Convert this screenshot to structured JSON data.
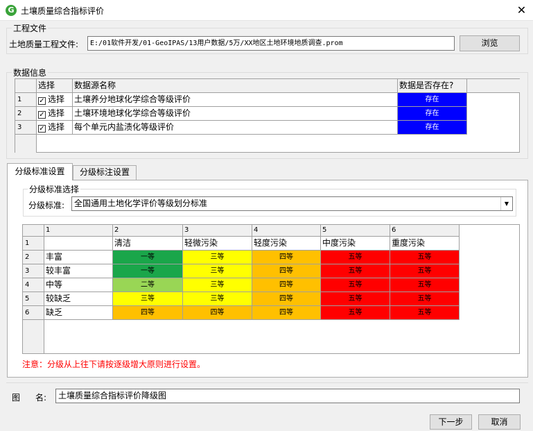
{
  "window": {
    "title": "土壤质量综合指标评价",
    "app_icon": "G",
    "close_glyph": "✕"
  },
  "project": {
    "group_label": "工程文件",
    "field_label": "土地质量工程文件:",
    "path": "E:/01软件开发/01-GeoIPAS/13用户数据/5万/XX地区土地环境地质调查.prom",
    "browse_label": "浏览"
  },
  "data_info": {
    "group_label": "数据信息",
    "columns": [
      "选择",
      "数据源名称",
      "数据是否存在?"
    ],
    "rows": [
      {
        "num": "1",
        "select_label": "选择",
        "checked": true,
        "name": "土壤养分地球化学综合等级评价",
        "status": "存在"
      },
      {
        "num": "2",
        "select_label": "选择",
        "checked": true,
        "name": "土壤环境地球化学综合等级评价",
        "status": "存在"
      },
      {
        "num": "3",
        "select_label": "选择",
        "checked": true,
        "name": "每个单元内盐渍化等级评价",
        "status": "存在"
      }
    ]
  },
  "tabs": [
    {
      "label": "分级标准设置",
      "active": true
    },
    {
      "label": "分级标注设置",
      "active": false
    }
  ],
  "standard": {
    "group_label": "分级标准选择",
    "field_label": "分级标准:",
    "value": "全国通用土地化学评价等级划分标准",
    "arrow": "▼"
  },
  "grade_grid": {
    "col_headers": [
      "1",
      "2",
      "3",
      "4",
      "5",
      "6"
    ],
    "row_headers": [
      "1",
      "2",
      "3",
      "4",
      "5",
      "6"
    ],
    "top_row": [
      "",
      "清洁",
      "轻微污染",
      "轻度污染",
      "中度污染",
      "重度污染"
    ],
    "rows": [
      {
        "label": "丰富",
        "cells": [
          "一等",
          "三等",
          "四等",
          "五等",
          "五等"
        ]
      },
      {
        "label": "较丰富",
        "cells": [
          "一等",
          "三等",
          "四等",
          "五等",
          "五等"
        ]
      },
      {
        "label": "中等",
        "cells": [
          "二等",
          "三等",
          "四等",
          "五等",
          "五等"
        ]
      },
      {
        "label": "较缺乏",
        "cells": [
          "三等",
          "三等",
          "四等",
          "五等",
          "五等"
        ]
      },
      {
        "label": "缺乏",
        "cells": [
          "四等",
          "四等",
          "四等",
          "五等",
          "五等"
        ]
      }
    ],
    "grade_colors": {
      "一等": "#1aa64a",
      "二等": "#99d655",
      "三等": "#ffff00",
      "四等": "#ffc000",
      "五等": "#ff0000"
    }
  },
  "note": "注意：分级从上往下请按逐级增大原则进行设置。",
  "map_name": {
    "label_1": "图",
    "label_2": "名:",
    "value": "土壤质量综合指标评价降级图"
  },
  "buttons": {
    "next": "下一步",
    "cancel": "取消"
  }
}
